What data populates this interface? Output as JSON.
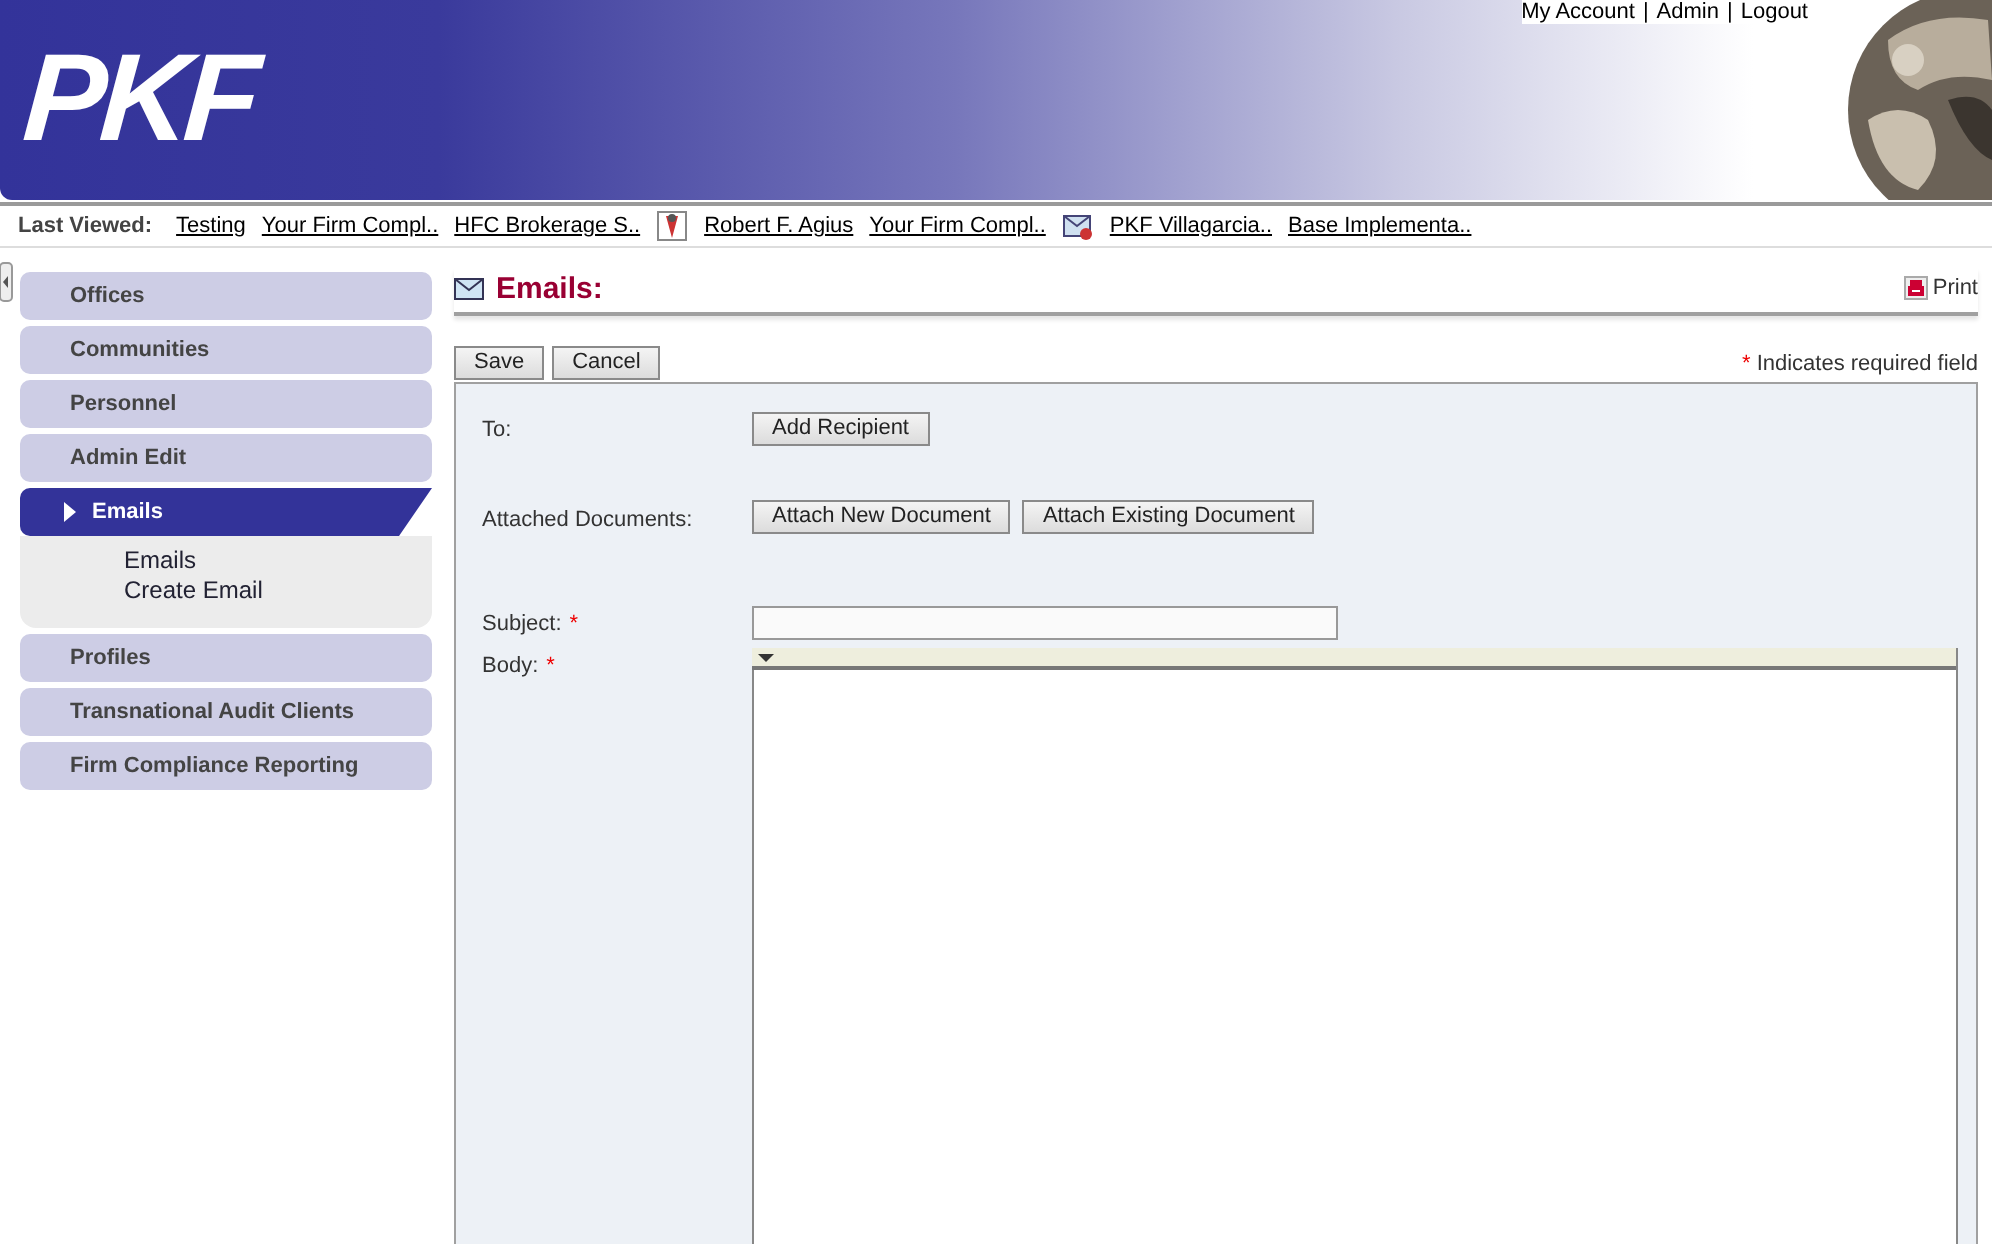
{
  "header": {
    "logo": "PKF",
    "links": [
      "My Account",
      "Admin",
      "Logout"
    ],
    "separator": "|"
  },
  "last_viewed": {
    "label": "Last Viewed:",
    "items": [
      {
        "text": "Testing",
        "kind": "plain"
      },
      {
        "text": "Your Firm Compl..",
        "kind": "plain"
      },
      {
        "text": "HFC Brokerage S..",
        "kind": "plain"
      },
      {
        "text": "Robert F. Agius",
        "kind": "person"
      },
      {
        "text": "Your Firm Compl..",
        "kind": "plain"
      },
      {
        "text": "PKF Villagarcia..",
        "kind": "office"
      },
      {
        "text": "Base Implementa..",
        "kind": "plain"
      }
    ]
  },
  "sidebar": {
    "items": [
      {
        "label": "Offices",
        "selected": false
      },
      {
        "label": "Communities",
        "selected": false
      },
      {
        "label": "Personnel",
        "selected": false
      },
      {
        "label": "Admin Edit",
        "selected": false
      },
      {
        "label": "Emails",
        "selected": true,
        "expanded": true,
        "children": [
          {
            "label": "Emails"
          },
          {
            "label": "Create Email"
          }
        ]
      },
      {
        "label": "Profiles",
        "selected": false
      },
      {
        "label": "Transnational Audit Clients",
        "selected": false
      },
      {
        "label": "Firm Compliance Reporting",
        "selected": false
      }
    ]
  },
  "page": {
    "title": "Emails:",
    "print": "Print",
    "buttons": [
      "Save",
      "Cancel"
    ],
    "required_note": "Indicates required field",
    "required_mark": "*"
  },
  "form": {
    "rows": [
      {
        "kind": "buttons",
        "label": "To:",
        "required": false,
        "buttons": [
          "Add Recipient"
        ]
      },
      {
        "kind": "buttons",
        "label": "Attached Documents:",
        "required": false,
        "buttons": [
          "Attach New Document",
          "Attach Existing Document"
        ]
      },
      {
        "kind": "text",
        "label": "Subject:",
        "required": true,
        "value": ""
      },
      {
        "kind": "editor",
        "label": "Body:",
        "required": true
      }
    ]
  }
}
